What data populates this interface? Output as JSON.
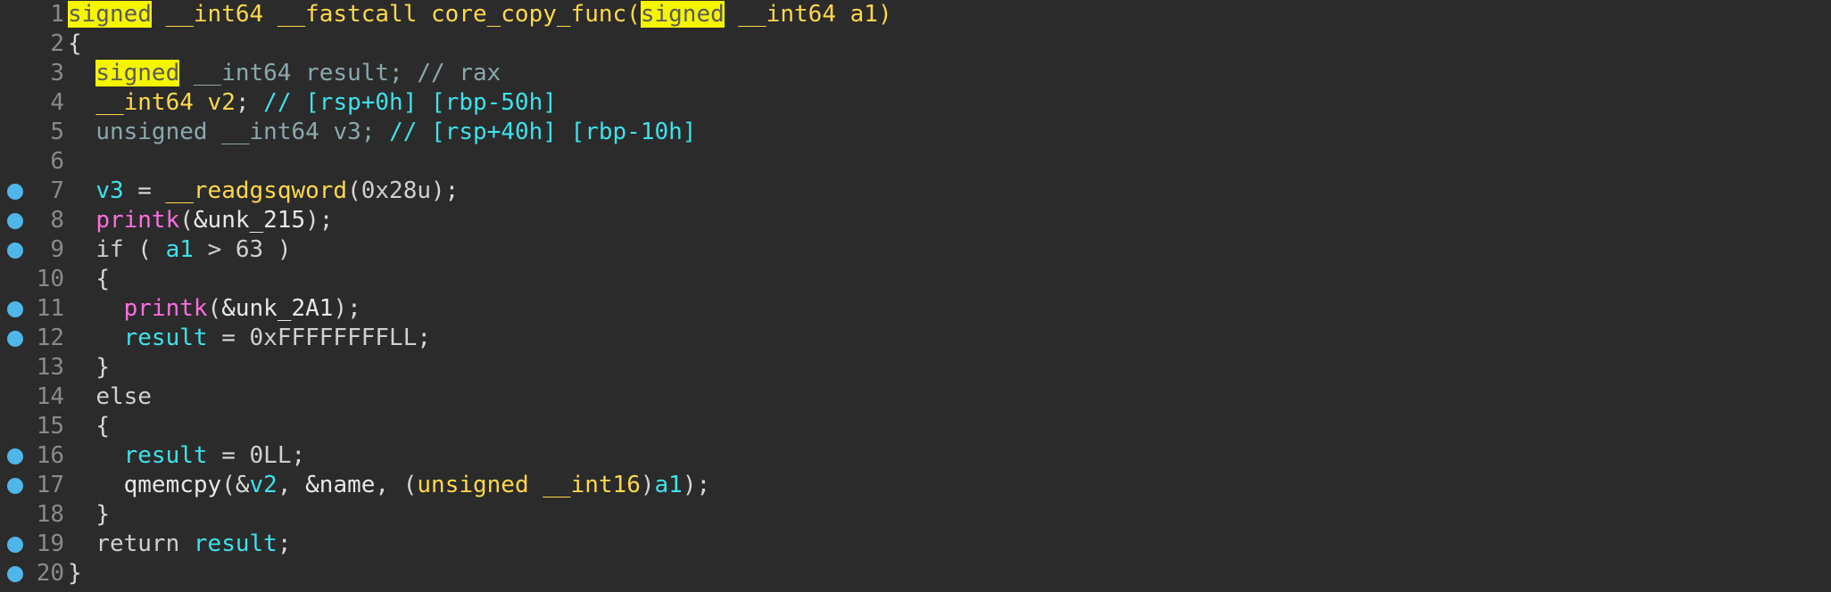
{
  "lines": [
    {
      "n": "1"
    },
    {
      "n": "2"
    },
    {
      "n": "3"
    },
    {
      "n": "4"
    },
    {
      "n": "5"
    },
    {
      "n": "6"
    },
    {
      "n": "7"
    },
    {
      "n": "8"
    },
    {
      "n": "9"
    },
    {
      "n": "10"
    },
    {
      "n": "11"
    },
    {
      "n": "12"
    },
    {
      "n": "13"
    },
    {
      "n": "14"
    },
    {
      "n": "15"
    },
    {
      "n": "16"
    },
    {
      "n": "17"
    },
    {
      "n": "18"
    },
    {
      "n": "19"
    },
    {
      "n": "20"
    }
  ],
  "tokens": {
    "signed": "signed",
    "int64": "__int64",
    "fastcall": "__fastcall",
    "func_name": "core_copy_func",
    "param_a1": "a1",
    "lbrace": "{",
    "rbrace": "}",
    "result": "result",
    "comment_rax": "// rax",
    "v2": "v2",
    "comment_v2": "// [rsp+0h] [rbp-50h]",
    "unsigned": "unsigned",
    "v3": "v3",
    "comment_v3": "// [rsp+40h] [rbp-10h]",
    "readgsqword": "__readgsqword",
    "hex28": "0x28u",
    "printk": "printk",
    "unk215": "&unk_215",
    "if_kw": "if",
    "cond_gt": "> 63",
    "unk2a1": "&unk_2A1",
    "ffff": "0xFFFFFFFFLL",
    "else_kw": "else",
    "zero": "0LL",
    "qmemcpy": "qmemcpy",
    "name": "&name",
    "int16": "__int16",
    "return_kw": "return"
  },
  "breakpoint_color": "#4fb6ea",
  "highlight_color": "#f5f500"
}
